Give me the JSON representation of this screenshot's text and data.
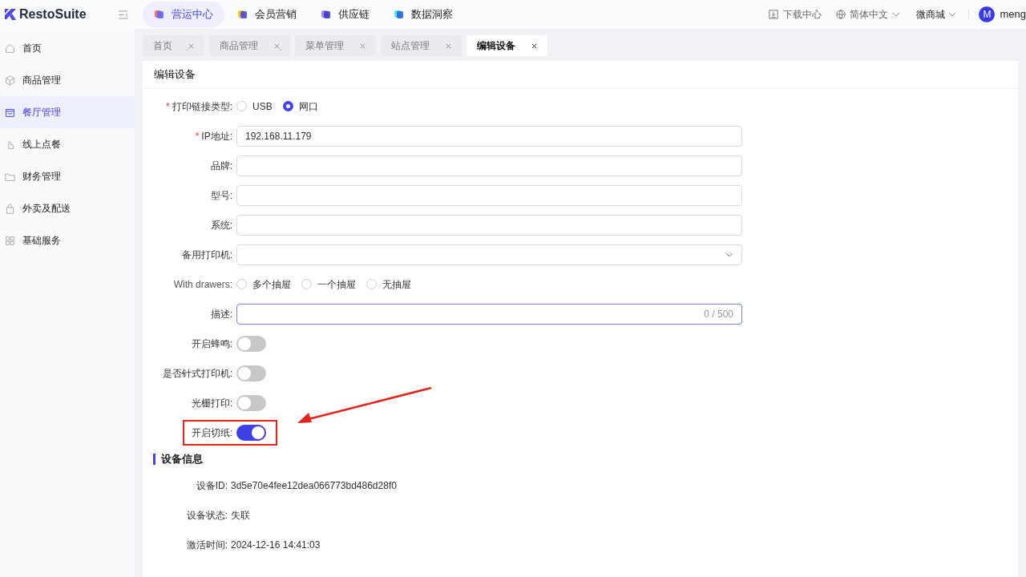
{
  "header": {
    "logo": "RestoSuite",
    "nav": [
      {
        "label": "营运中心",
        "selected": true
      },
      {
        "label": "会员营销",
        "selected": false
      },
      {
        "label": "供应链",
        "selected": false
      },
      {
        "label": "数据洞察",
        "selected": false
      }
    ],
    "download": "下载中心",
    "language": "简体中文",
    "store": "微商城",
    "avatar": "M",
    "user": "meng"
  },
  "sidebar": {
    "items": [
      {
        "label": "首页",
        "selected": false
      },
      {
        "label": "商品管理",
        "selected": false
      },
      {
        "label": "餐厅管理",
        "selected": true
      },
      {
        "label": "线上点餐",
        "selected": false
      },
      {
        "label": "财务管理",
        "selected": false
      },
      {
        "label": "外卖及配送",
        "selected": false
      },
      {
        "label": "基础服务",
        "selected": false
      }
    ]
  },
  "tabs": [
    {
      "label": "首页",
      "selected": false
    },
    {
      "label": "商品管理",
      "selected": false
    },
    {
      "label": "菜单管理",
      "selected": false
    },
    {
      "label": "站点管理",
      "selected": false
    },
    {
      "label": "编辑设备",
      "selected": true
    }
  ],
  "page": {
    "title": "编辑设备",
    "fields": [
      {
        "kind": "radio",
        "label": "打印链接类型:",
        "required_mark": "*",
        "options": [
          {
            "label": "USB",
            "selected": false
          },
          {
            "label": "网口",
            "selected": true
          }
        ]
      },
      {
        "kind": "input",
        "label": "IP地址:",
        "required_mark": "*",
        "value": "192.168.11.179"
      },
      {
        "kind": "input",
        "label": "品牌:"
      },
      {
        "kind": "input",
        "label": "型号:"
      },
      {
        "kind": "input",
        "label": "系统:"
      },
      {
        "kind": "select",
        "label": "备用打印机:"
      },
      {
        "kind": "radio",
        "label": "With drawers:",
        "options": [
          {
            "label": "多个抽屉",
            "selected": false
          },
          {
            "label": "一个抽屉",
            "selected": false
          },
          {
            "label": "无抽屉",
            "selected": false
          }
        ]
      },
      {
        "kind": "textarea",
        "label": "描述:",
        "counter": "0 / 500",
        "focused": true
      },
      {
        "kind": "switch",
        "label": "开启蜂鸣:",
        "on": false
      },
      {
        "kind": "switch",
        "label": "是否针式打印机:",
        "on": false
      },
      {
        "kind": "switch",
        "label": "光栅打印:",
        "on": false
      },
      {
        "kind": "switch",
        "label": "开启切纸:",
        "on": true,
        "highlighted": true
      }
    ],
    "section": "设备信息",
    "info": [
      {
        "label": "设备ID:",
        "value": "3d5e70e4fee12dea066773bd486d28f0"
      },
      {
        "label": "设备状态:",
        "value": "失联"
      },
      {
        "label": "激活时间:",
        "value": "2024-12-16 14:41:03"
      }
    ]
  }
}
